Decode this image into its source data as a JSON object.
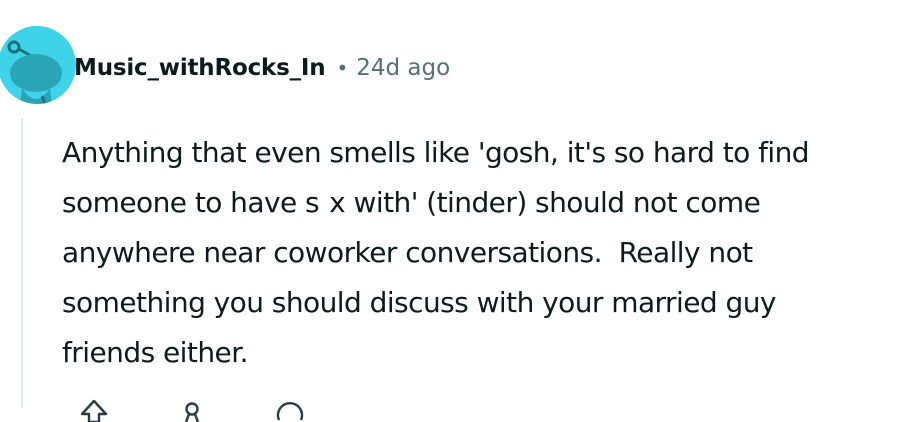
{
  "comment": {
    "author": "Music_withRocks_In",
    "separator": "•",
    "age": "24d ago",
    "body_lines": [
      "Anything that even smells like 'gosh, it's so hard to find",
      "someone to have s  x with' (tinder) should not come",
      "anywhere near coworker conversations.  Really not",
      "something you should discuss with your married guy",
      "friends either."
    ]
  },
  "avatar": {
    "icon": "snoo-avatar-icon",
    "background": "#3fd3e9"
  },
  "actions": {
    "icons": [
      "upvote-icon",
      "award-icon",
      "reply-icon"
    ]
  },
  "colors": {
    "text": "#0f1a1c",
    "meta": "#576f76",
    "thread_line": "#e5ebee"
  }
}
